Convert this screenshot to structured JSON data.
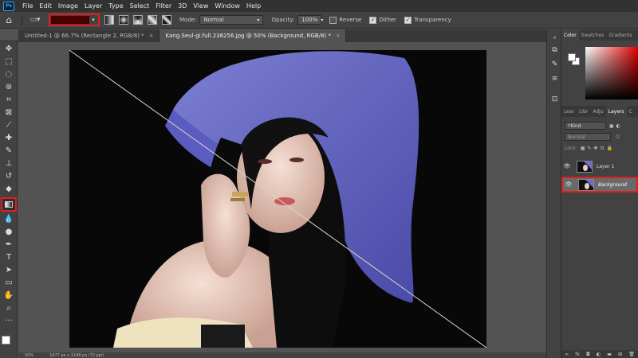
{
  "menu": [
    "File",
    "Edit",
    "Image",
    "Layer",
    "Type",
    "Select",
    "Filter",
    "3D",
    "View",
    "Window",
    "Help"
  ],
  "app_logo": "Ps",
  "options": {
    "mode_label": "Mode:",
    "mode_value": "Normal",
    "opacity_label": "Opacity:",
    "opacity_value": "100%",
    "reverse_label": "Reverse",
    "dither_label": "Dither",
    "transparency_label": "Transparency",
    "reverse_checked": false,
    "dither_checked": true,
    "transparency_checked": true,
    "gradient_color": "#4b0000"
  },
  "tabs": [
    {
      "label": "Untitled-1 @ 66.7% (Rectangle 2, RGB/8) *",
      "active": false
    },
    {
      "label": "Kang.Seul-gi.full.236256.jpg @ 50% (Background, RGB/8) *",
      "active": true
    }
  ],
  "tools": [
    "move-icon",
    "marquee-icon",
    "lasso-icon",
    "quick-select-icon",
    "crop-icon",
    "frame-icon",
    "eyedropper-icon",
    "healing-icon",
    "brush-icon",
    "stamp-icon",
    "history-brush-icon",
    "eraser-icon",
    "gradient-icon",
    "blur-icon",
    "dodge-icon",
    "pen-icon",
    "type-icon",
    "path-select-icon",
    "rectangle-icon",
    "hand-icon",
    "zoom-icon",
    "more-icon"
  ],
  "status": {
    "zoom": "50%",
    "doc_info": "1677 px x 1198 px (72 ppi)"
  },
  "panels": {
    "color_tabs": [
      "Color",
      "Swatches",
      "Gradients"
    ],
    "layer_tabs": [
      "Lear",
      "Libr",
      "Adju",
      "Layers",
      "C"
    ],
    "kind_label": "Kind",
    "blend_mode": "Normal",
    "opacity_short": "O",
    "lock_label": "Lock:",
    "layers": [
      {
        "name": "Layer 1",
        "selected": false
      },
      {
        "name": "Background",
        "selected": true
      }
    ]
  }
}
